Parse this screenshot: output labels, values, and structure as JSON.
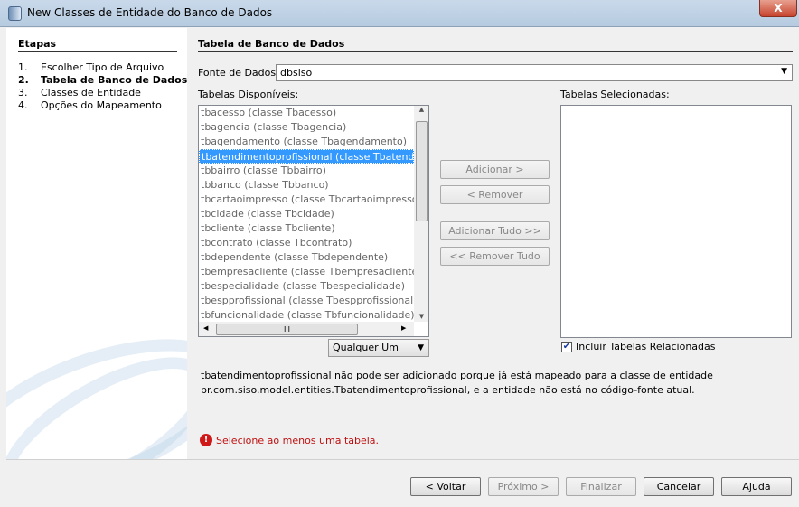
{
  "window": {
    "title": "New Classes de Entidade do Banco de Dados",
    "close": "X"
  },
  "steps": {
    "title": "Etapas",
    "items": [
      {
        "n": "1.",
        "label": "Escolher Tipo de Arquivo"
      },
      {
        "n": "2.",
        "label": "Tabela de Banco de Dados",
        "current": true
      },
      {
        "n": "3.",
        "label": "Classes de Entidade"
      },
      {
        "n": "4.",
        "label": "Opções do Mapeamento"
      }
    ]
  },
  "main": {
    "title": "Tabela de Banco de Dados",
    "fonte_label": "Fonte de Dados:",
    "fonte_value": "dbsiso",
    "available_label": "Tabelas Disponíveis:",
    "selected_label": "Tabelas Selecionadas:",
    "tables": [
      "tbacesso (classe Tbacesso)",
      "tbagencia (classe Tbagencia)",
      "tbagendamento (classe Tbagendamento)",
      "tbatendimentoprofissional (classe Tbatendimentoprofissional)",
      "tbbairro (classe Tbbairro)",
      "tbbanco (classe Tbbanco)",
      "tbcartaoimpresso (classe Tbcartaoimpresso)",
      "tbcidade (classe Tbcidade)",
      "tbcliente (classe Tbcliente)",
      "tbcontrato (classe Tbcontrato)",
      "tbdependente (classe Tbdependente)",
      "tbempresacliente (classe Tbempresacliente)",
      "tbespecialidade (classe Tbespecialidade)",
      "tbespprofissional (classe Tbespprofissional)",
      "tbfuncionalidade (classe Tbfuncionalidade)"
    ],
    "selected_index": 3,
    "filter": "Qualquer Um",
    "hscroll_grip": "III",
    "buttons": {
      "add": "Adicionar >",
      "remove": "< Remover",
      "add_all": "Adicionar Tudo >>",
      "remove_all": "<< Remover Tudo"
    },
    "include_related": "Incluir Tabelas Relacionadas",
    "message_line1": "tbatendimentoprofissional não pode ser adicionado porque já está mapeado para a classe de entidade",
    "message_line2": "br.com.siso.model.entities.Tbatendimentoprofissional, e a entidade não está no código-fonte atual.",
    "error": "Selecione ao menos uma tabela."
  },
  "footer": {
    "back": "< Voltar",
    "next": "Próximo >",
    "finish": "Finalizar",
    "cancel": "Cancelar",
    "help": "Ajuda"
  }
}
